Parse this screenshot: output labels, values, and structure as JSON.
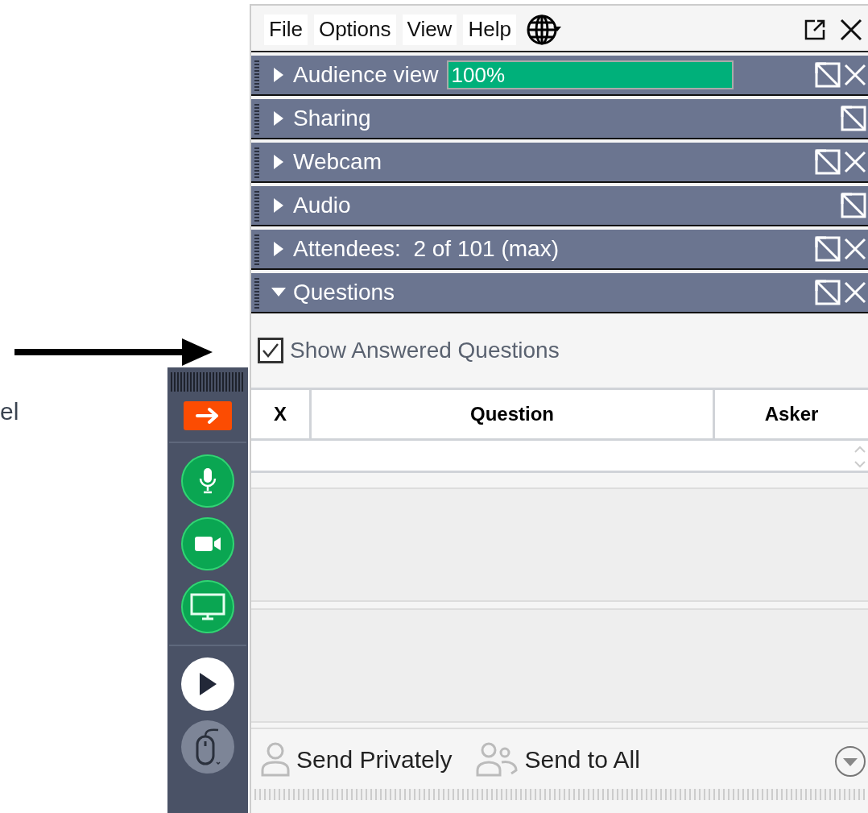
{
  "annotation": {
    "partial_text": "el"
  },
  "toolbar": [
    {
      "kind": "exit"
    },
    {
      "kind": "divider"
    },
    {
      "kind": "mic"
    },
    {
      "kind": "camera"
    },
    {
      "kind": "screen"
    },
    {
      "kind": "divider"
    },
    {
      "kind": "play"
    },
    {
      "kind": "mouse"
    }
  ],
  "menu": [
    {
      "label": "File"
    },
    {
      "label": "Options"
    },
    {
      "label": "View"
    },
    {
      "label": "Help"
    }
  ],
  "sections": [
    {
      "title": "Audience view",
      "expanded": false,
      "closable": true,
      "progress": {
        "level": 1,
        "reading": "100%"
      }
    },
    {
      "title": "Sharing",
      "expanded": false,
      "closable": false
    },
    {
      "title": "Webcam",
      "expanded": false,
      "closable": true
    },
    {
      "title": "Audio",
      "expanded": false,
      "closable": false
    },
    {
      "title": "Attendees:  2 of 101 (max)",
      "expanded": false,
      "closable": true
    },
    {
      "title": "Questions",
      "expanded": true,
      "closable": true
    }
  ],
  "questions": {
    "show_answered": {
      "label": "Show Answered Questions",
      "checked": true
    },
    "columns": [
      "X",
      "Question",
      "Asker"
    ]
  },
  "footer": {
    "buttons": [
      {
        "label": "Send Privately",
        "kind": "person"
      },
      {
        "label": "Send to All",
        "kind": "group"
      }
    ]
  }
}
